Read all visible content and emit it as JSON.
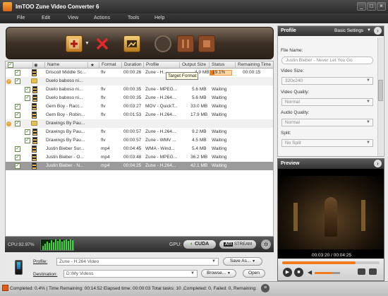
{
  "window": {
    "title": "ImTOO Zune Video Converter 6",
    "minimize": "_",
    "maximize": "□",
    "close": "×"
  },
  "menu": [
    "File",
    "Edit",
    "View",
    "Actions",
    "Tools",
    "Help"
  ],
  "grid": {
    "headers": [
      "Name",
      "★",
      "Format",
      "Duration",
      "Profile",
      "Output Size",
      "Status",
      "Remaining Time"
    ],
    "rows": [
      {
        "name": "Driscoll Middle Sc...",
        "format": "flv",
        "duration": "00:00:26",
        "profile": "Zune - H...",
        "size": "4.9 MB",
        "status": "19.1%",
        "remaining": "00:00:15"
      },
      {
        "name": "Duelo baboso ni...",
        "format": "",
        "duration": "",
        "profile": "",
        "size": "",
        "status": "",
        "remaining": ""
      },
      {
        "name": "Duelo baboso ni...",
        "format": "flv",
        "duration": "00:00:35",
        "profile": "Zune - MPEG...",
        "size": "5.6 MB",
        "status": "Waiting",
        "remaining": ""
      },
      {
        "name": "Duelo baboso ni...",
        "format": "flv",
        "duration": "00:00:35",
        "profile": "Zune - H.264...",
        "size": "5.6 MB",
        "status": "Waiting",
        "remaining": ""
      },
      {
        "name": "Gem Boy - Racc...",
        "format": "flv",
        "duration": "00:03:27",
        "profile": "MOV - QuickT...",
        "size": "33.0 MB",
        "status": "Waiting",
        "remaining": ""
      },
      {
        "name": "Gem Boy - Robin...",
        "format": "flv",
        "duration": "00:01:53",
        "profile": "Zune - H.264...",
        "size": "17.9 MB",
        "status": "Waiting",
        "remaining": ""
      },
      {
        "name": "Drawings By Pau...",
        "format": "",
        "duration": "",
        "profile": "",
        "size": "",
        "status": "",
        "remaining": ""
      },
      {
        "name": "Drawings By Pau...",
        "format": "flv",
        "duration": "00:00:57",
        "profile": "Zune - H.264...",
        "size": "9.2 MB",
        "status": "Waiting",
        "remaining": ""
      },
      {
        "name": "Drawings By Pau...",
        "format": "flv",
        "duration": "00:00:57",
        "profile": "Zune - WMV ...",
        "size": "4.5 MB",
        "status": "Waiting",
        "remaining": ""
      },
      {
        "name": "Justin Bieber Sur...",
        "format": "mp4",
        "duration": "00:04:45",
        "profile": "WMA - Wind...",
        "size": "5.4 MB",
        "status": "Waiting",
        "remaining": ""
      },
      {
        "name": "Justin Bieber - O...",
        "format": "mp4",
        "duration": "00:03:48",
        "profile": "Zune - MPEG...",
        "size": "36.2 MB",
        "status": "Waiting",
        "remaining": ""
      },
      {
        "name": "Justin Bieber - N...",
        "format": "mp4",
        "duration": "00:04:25",
        "profile": "Zune - H.264...",
        "size": "42.1 MB",
        "status": "Waiting",
        "remaining": ""
      }
    ],
    "tooltip": "Target Format"
  },
  "progress_value": 0.191,
  "cpu": {
    "label": "CPU:92.97%",
    "gpu_label": "GPU:",
    "cuda": "CUDA",
    "stream": "STREAM",
    "ati": "ATI"
  },
  "output": {
    "profile_label": "Profile:",
    "profile_value": "Zune - H.264 Video",
    "save_as": "Save As...",
    "destination_label": "Destination:",
    "destination_value": "D:\\My Videos",
    "browse": "Browse...",
    "open": "Open"
  },
  "status": {
    "text": "Completed: 0.4% | Time Remaining: 00:14:52 Elapsed time: 00:00:03 Total tasks: 10 ,Completed: 0, Failed: 0, Remaining:"
  },
  "profile_panel": {
    "title": "Profile",
    "settings": "Basic Settings",
    "file_name_label": "File Name:",
    "file_name": "Justin Bieber - Never Let You Go",
    "video_size_label": "Video Size:",
    "video_size": "320x240",
    "video_quality_label": "Video Quality:",
    "video_quality": "Normal",
    "audio_quality_label": "Audio Quality:",
    "audio_quality": "Normal",
    "split_label": "Split:",
    "split": "No Split"
  },
  "preview": {
    "title": "Preview",
    "time": "00:03:20 / 00:04:25",
    "position": 0.755
  }
}
